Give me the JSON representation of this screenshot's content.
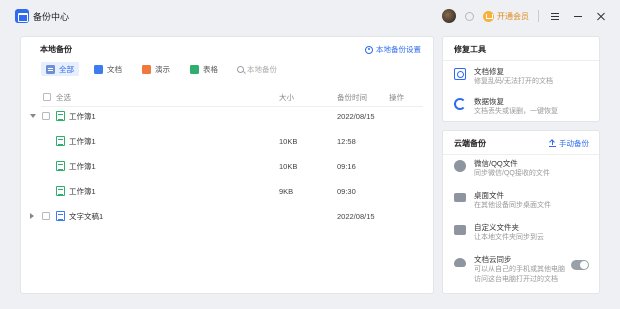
{
  "titlebar": {
    "title": "备份中心",
    "vip_label": "开通会员"
  },
  "local": {
    "title": "本地备份",
    "settings_label": "本地备份设置",
    "filters": [
      {
        "label": "全部",
        "icon": "all-icon",
        "active": true
      },
      {
        "label": "文档",
        "icon": "doc-icon"
      },
      {
        "label": "演示",
        "icon": "ppt-icon"
      },
      {
        "label": "表格",
        "icon": "xls-icon"
      }
    ],
    "search_placeholder": "本地备份",
    "columns": {
      "select_all": "全选",
      "size": "大小",
      "time": "备份时间",
      "op": "操作"
    },
    "rows": [
      {
        "name": "工作簿1",
        "size": "",
        "time": "2022/08/15",
        "level": "parent",
        "expanded": true,
        "type": "xls"
      },
      {
        "name": "工作簿1",
        "size": "10KB",
        "time": "12:58",
        "level": "child",
        "type": "xls"
      },
      {
        "name": "工作簿1",
        "size": "10KB",
        "time": "09:16",
        "level": "child",
        "type": "xls"
      },
      {
        "name": "工作簿1",
        "size": "9KB",
        "time": "09:30",
        "level": "child",
        "type": "xls"
      },
      {
        "name": "文字文稿1",
        "size": "",
        "time": "2022/08/15",
        "level": "parent",
        "expanded": false,
        "type": "doc"
      }
    ]
  },
  "repair": {
    "title": "修复工具",
    "items": [
      {
        "title": "文档修复",
        "desc": "修复乱码/无法打开的文档",
        "icon": "repair-icon"
      },
      {
        "title": "数据恢复",
        "desc": "文档丢失或误删，一键恢复",
        "icon": "recover-icon"
      }
    ]
  },
  "cloud": {
    "title": "云端备份",
    "manual_label": "手动备份",
    "items": [
      {
        "title": "微信/QQ文件",
        "desc": "同步微信/QQ接收的文件",
        "icon": "wechat-icon"
      },
      {
        "title": "桌面文件",
        "desc": "在其他设备同步桌面文件",
        "icon": "desktop-icon"
      },
      {
        "title": "自定义文件夹",
        "desc": "让本地文件夹同步到云",
        "icon": "folder-icon"
      },
      {
        "title": "文档云同步",
        "desc": "可以从自己的手机或其他电脑",
        "desc2": "访问这台电脑打开过的文档",
        "icon": "cloud-icon",
        "toggle": true
      }
    ]
  }
}
